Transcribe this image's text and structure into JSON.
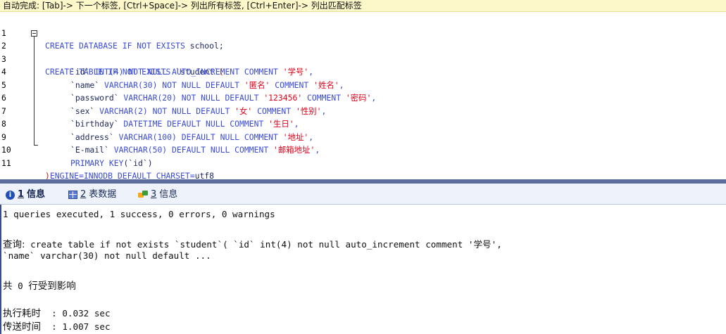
{
  "hint": "自动完成: [Tab]-> 下一个标签, [Ctrl+Space]-> 列出所有标签, [Ctrl+Enter]-> 列出匹配标签",
  "line_numbers": [
    "1",
    "2",
    "3",
    "4",
    "5",
    "6",
    "7",
    "8",
    "9",
    "10",
    "11"
  ],
  "code": {
    "l1": {
      "kw": "CREATE DATABASE IF NOT EXISTS",
      "rest": " school;"
    },
    "l2": {
      "kw": "CREATE TABLE IF NOT EXISTS",
      "name": " `student`",
      "paren": "("
    },
    "l3": {
      "id": "`id`",
      "type": " INT(4) NOT NULL AUTO_INCREMENT COMMENT ",
      "comment": "'学号'",
      "tail": ","
    },
    "l4": {
      "id": "`name`",
      "type": " VARCHAR(30) NOT NULL DEFAULT ",
      "def": "'匿名'",
      "mid": " COMMENT ",
      "comment": "'姓名'",
      "tail": ","
    },
    "l5": {
      "id": "`password`",
      "type": " VARCHAR(20) NOT NULL DEFAULT ",
      "def": "'123456'",
      "mid": " COMMENT ",
      "comment": "'密码'",
      "tail": ","
    },
    "l6": {
      "id": "`sex`",
      "type": " VARCHAR(2) NOT NULL DEFAULT ",
      "def": "'女'",
      "mid": " COMMENT ",
      "comment": "'性别'",
      "tail": ","
    },
    "l7": {
      "id": "`birthday`",
      "type": " DATETIME DEFAULT NULL COMMENT ",
      "comment": "'生日'",
      "tail": ","
    },
    "l8": {
      "id": "`address`",
      "type": " VARCHAR(100) DEFAULT NULL COMMENT ",
      "comment": "'地址'",
      "tail": ","
    },
    "l9": {
      "id": "`E-mail`",
      "type": " VARCHAR(50) DEFAULT NULL COMMENT ",
      "comment": "'邮箱地址'",
      "tail": ","
    },
    "l10": {
      "kw": "PRIMARY KEY",
      "rest": "(`id`)"
    },
    "l11": {
      "paren": ")",
      "kw": "ENGINE=INNODB DEFAULT CHARSET=",
      "rest": "utf8"
    }
  },
  "tabs": [
    {
      "num": "1",
      "label": "信息"
    },
    {
      "num": "2",
      "label": "表数据"
    },
    {
      "num": "3",
      "label": "信息"
    }
  ],
  "output": {
    "summary": "1 queries executed, 1 success, 0 errors, 0 warnings",
    "query_label": "查询:",
    "query_text": " create table if not exists `student`( `id` int(4) not null auto_increment comment '学号',",
    "query_text2": "`name` varchar(30) not null default ...",
    "affected_pre": "共",
    "affected_num": " 0 ",
    "affected_post": "行受到影响",
    "exec_label": "执行耗时",
    "exec_value": "  : 0.032 sec",
    "transfer_label": "传送时间",
    "transfer_value": "  : 1.007 sec"
  },
  "colors": {
    "keyword": "#3a4bd8",
    "string": "#e2001a",
    "tab_accent": "#5c6c9c"
  }
}
